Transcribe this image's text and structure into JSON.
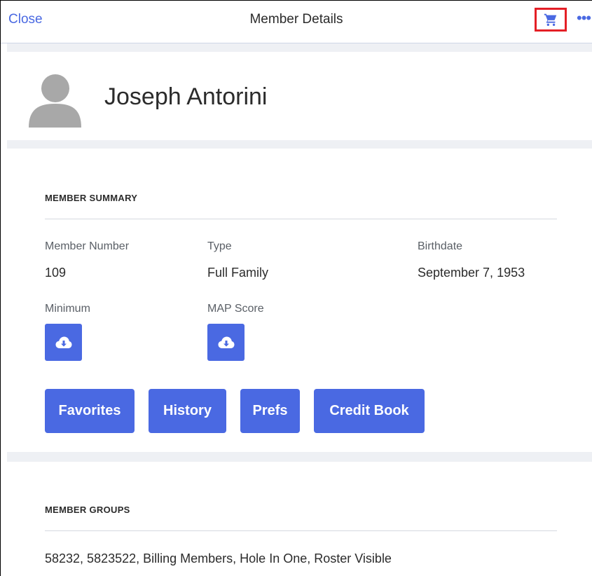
{
  "header": {
    "close_label": "Close",
    "title": "Member Details",
    "more_label": "•••"
  },
  "profile": {
    "name": "Joseph Antorini"
  },
  "summary": {
    "section_title": "MEMBER SUMMARY",
    "member_number_label": "Member Number",
    "member_number": "109",
    "type_label": "Type",
    "type_value": "Full Family",
    "birthdate_label": "Birthdate",
    "birthdate": "September 7, 1953",
    "minimum_label": "Minimum",
    "map_score_label": "MAP Score"
  },
  "actions": {
    "favorites": "Favorites",
    "history": "History",
    "prefs": "Prefs",
    "credit_book": "Credit Book"
  },
  "groups": {
    "section_title": "MEMBER GROUPS",
    "list": "58232, 5823522, Billing Members, Hole In One, Roster Visible"
  },
  "colors": {
    "accent": "#4a69e2",
    "highlight_box": "#e41f26",
    "separator": "#eef0f4"
  }
}
